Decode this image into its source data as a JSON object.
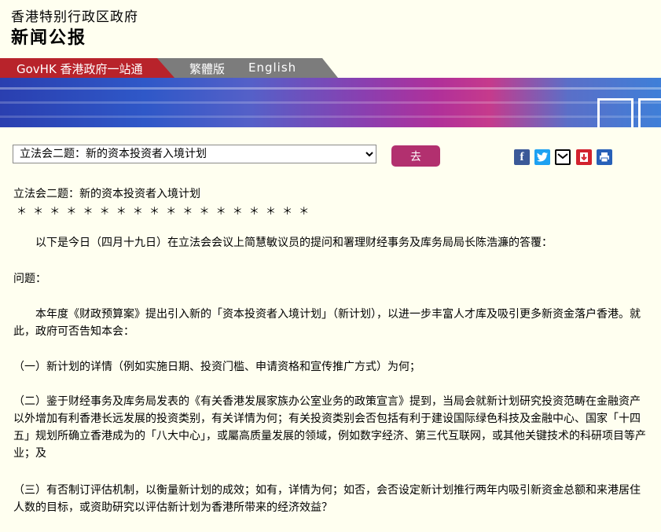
{
  "header": {
    "gov_name": "香港特别行政区政府",
    "press_title": "新闻公报"
  },
  "nav": {
    "govhk": "GovHK 香港政府一站通",
    "traditional": "繁體版",
    "english": "English"
  },
  "toolbar": {
    "select_value": "立法会二题：新的资本投资者入境计划",
    "go_label": "去"
  },
  "share_icons": [
    "facebook-icon",
    "twitter-icon",
    "email-icon",
    "pdf-icon",
    "print-icon"
  ],
  "article": {
    "title": "立法会二题：新的资本投资者入境计划",
    "stars": "＊ ＊ ＊ ＊ ＊ ＊ ＊ ＊ ＊ ＊ ＊ ＊ ＊ ＊ ＊ ＊ ＊ ＊",
    "intro": "　　以下是今日（四月十九日）在立法会会议上简慧敏议员的提问和署理财经事务及库务局局长陈浩濂的答覆：",
    "question_heading": "问题：",
    "q_para1": "　　本年度《财政预算案》提出引入新的「资本投资者入境计划」（新计划），以进一步丰富人才库及吸引更多新资金落户香港。就此，政府可否告知本会：",
    "q1": "（一）新计划的详情（例如实施日期、投资门槛、申请资格和宣传推广方式）为何；",
    "q2": "（二）鉴于财经事务及库务局发表的《有关香港发展家族办公室业务的政策宣言》提到，当局会就新计划研究投资范畴在金融资产以外增加有利香港长远发展的投资类别，有关详情为何；有关投资类别会否包括有利于建设国际绿色科技及金融中心、国家「十四五」规划所确立香港成为的「八大中心」，或屬高质量发展的领域，例如数字经济、第三代互联网，或其他关键技术的科研项目等产业；及",
    "q3": "（三）有否制订评估机制，以衡量新计划的成效；如有，详情为何；如否，会否设定新计划推行两年内吸引新资金总额和来港居住人数的目标，或资助研究以评估新计划为香港所带来的经济效益？"
  },
  "colors": {
    "background": "#fffff0",
    "nav_red": "#b8232b",
    "nav_gray": "#7c7c7c",
    "go_button": "#b2306f"
  }
}
